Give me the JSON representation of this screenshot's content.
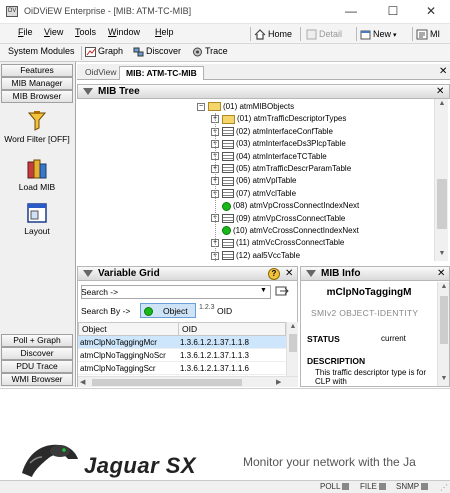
{
  "window": {
    "title": "OiDViEW Enterprise - [MIB: ATM-TC-MIB]",
    "app_icon_text": "OV",
    "minimize": "—",
    "maximize": "☐",
    "close": "✕"
  },
  "menu": {
    "items": [
      {
        "label": "File",
        "key": "F",
        "rest": "ile"
      },
      {
        "label": "View",
        "key": "V",
        "rest": "iew"
      },
      {
        "label": "Tools",
        "key": "T",
        "rest": "ools"
      },
      {
        "label": "Window",
        "key": "W",
        "rest": "indow"
      },
      {
        "label": "Help",
        "key": "H",
        "rest": "elp"
      }
    ],
    "home": "Home",
    "detail": "Detail",
    "new": "New",
    "cut_off": "MI"
  },
  "toolbar": {
    "system_modules": "System Modules",
    "graph": "Graph",
    "discover": "Discover",
    "trace": "Trace"
  },
  "left_panel": {
    "top_tabs": [
      "Features",
      "MIB Manager",
      "MIB Browser"
    ],
    "items": [
      {
        "label": "Word Filter [OFF]",
        "icon": "funnel-icon"
      },
      {
        "label": "Load MIB",
        "icon": "books-icon"
      },
      {
        "label": "Layout",
        "icon": "layout-icon"
      }
    ],
    "bottom_tabs": [
      "Poll + Graph",
      "Discover",
      "PDU Trace",
      "WMI Browser"
    ]
  },
  "tabs": [
    {
      "label": "OidView",
      "active": false
    },
    {
      "label": "MIB: ATM-TC-MIB",
      "active": true
    }
  ],
  "mib_tree": {
    "title": "MIB Tree",
    "close": "✕",
    "rows": [
      {
        "label": "(01) atmMIBObjects",
        "type": "folder",
        "expander": "−",
        "indent": 1
      },
      {
        "label": "(01) atmTrafficDescriptorTypes",
        "type": "folder",
        "expander": "+",
        "indent": 2
      },
      {
        "label": "(02) atmInterfaceConfTable",
        "type": "table",
        "expander": "+",
        "indent": 2
      },
      {
        "label": "(03) atmInterfaceDs3PlcpTable",
        "type": "table",
        "expander": "+",
        "indent": 2
      },
      {
        "label": "(04) atmInterfaceTCTable",
        "type": "table",
        "expander": "+",
        "indent": 2
      },
      {
        "label": "(05) atmTrafficDescrParamTable",
        "type": "table",
        "expander": "+",
        "indent": 2
      },
      {
        "label": "(06) atmVplTable",
        "type": "table",
        "expander": "+",
        "indent": 2
      },
      {
        "label": "(07) atmVclTable",
        "type": "table",
        "expander": "+",
        "indent": 2
      },
      {
        "label": "(08) atmVpCrossConnectIndexNext",
        "type": "leaf",
        "expander": "",
        "indent": 2
      },
      {
        "label": "(09) atmVpCrossConnectTable",
        "type": "table",
        "expander": "+",
        "indent": 2
      },
      {
        "label": "(10) atmVcCrossConnectIndexNext",
        "type": "leaf",
        "expander": "",
        "indent": 2
      },
      {
        "label": "(11) atmVcCrossConnectTable",
        "type": "table",
        "expander": "+",
        "indent": 2
      },
      {
        "label": "(12) aal5VccTable",
        "type": "table",
        "expander": "+",
        "indent": 2
      }
    ]
  },
  "variable_grid": {
    "title": "Variable Grid",
    "help": "?",
    "search_label": "Search ->",
    "search_value": "",
    "search_by": "Search By ->",
    "option_object": "Object",
    "option_oid": "OID",
    "col_object": "Object",
    "col_oid": "OID",
    "rows": [
      {
        "object": "atmClpNoTaggingMcr",
        "oid": "1.3.6.1.2.1.37.1.1.8",
        "selected": true
      },
      {
        "object": "atmClpNoTaggingNoScr",
        "oid": "1.3.6.1.2.1.37.1.1.3",
        "selected": false
      },
      {
        "object": "atmClpNoTaggingScr",
        "oid": "1.3.6.1.2.1.37.1.1.6",
        "selected": false
      }
    ]
  },
  "mib_info": {
    "title": "MIB Info",
    "object_name": "mClpNoTaggingM",
    "syntax": "SMIv2 OBJECT-IDENTITY",
    "status_label": "STATUS",
    "status_value": "current",
    "description_label": "DESCRIPTION",
    "description_text": "This traffic descriptor type is for CLP with"
  },
  "banner": {
    "logo_text": "Jaguar SX",
    "tagline": "Monitor your network with the Ja"
  },
  "status_bar": {
    "items": [
      "POLL",
      "FILE",
      "SNMP"
    ]
  },
  "colors": {
    "accent_blue": "#cfe3f7",
    "green_leaf": "#18b818",
    "selected_row": "#cde6fb"
  }
}
